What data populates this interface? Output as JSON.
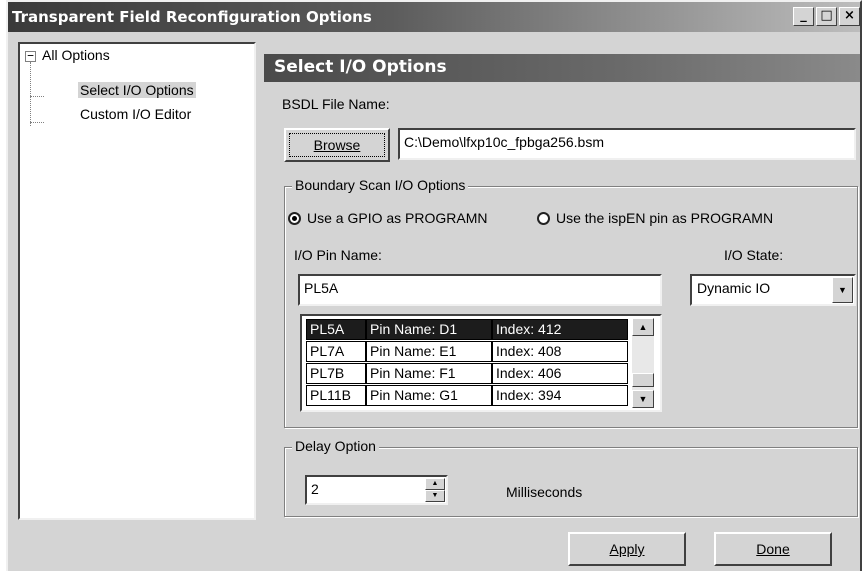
{
  "window": {
    "title": "Transparent Field Reconfiguration Options",
    "minimize_glyph": "_",
    "maximize_glyph": "□",
    "close_glyph": "×"
  },
  "tree": {
    "expander": "−",
    "root": "All Options",
    "items": [
      "Select I/O Options",
      "Custom I/O Editor"
    ],
    "selected_index": 0
  },
  "panel": {
    "header": "Select I/O Options",
    "bsdl_label": "BSDL File Name:",
    "browse_label": "Browse",
    "bsdl_path": "C:\\Demo\\lfxp10c_fpbga256.bsm"
  },
  "boundary_scan": {
    "legend": "Boundary Scan I/O Options",
    "radio_gpio": "Use a GPIO as PROGRAMN",
    "radio_ispen": "Use the ispEN pin as PROGRAMN",
    "selected_radio": "gpio",
    "pin_name_label": "I/O Pin Name:",
    "pin_name_value": "PL5A",
    "io_state_label": "I/O State:",
    "io_state_value": "Dynamic IO",
    "pins": [
      {
        "name": "PL5A",
        "pin": "Pin Name: D1",
        "index": "Index: 412",
        "selected": true
      },
      {
        "name": "PL7A",
        "pin": "Pin Name: E1",
        "index": "Index: 408",
        "selected": false
      },
      {
        "name": "PL7B",
        "pin": "Pin Name: F1",
        "index": "Index: 406",
        "selected": false
      },
      {
        "name": "PL11B",
        "pin": "Pin Name: G1",
        "index": "Index: 394",
        "selected": false
      }
    ]
  },
  "delay": {
    "legend": "Delay Option",
    "value": "2",
    "unit": "Milliseconds"
  },
  "footer": {
    "apply_label": "Apply",
    "done_label": "Done"
  },
  "icons": {
    "scroll_up": "▲",
    "scroll_down": "▼",
    "combo_arrow": "▼",
    "spin_up": "▲",
    "spin_down": "▼"
  }
}
